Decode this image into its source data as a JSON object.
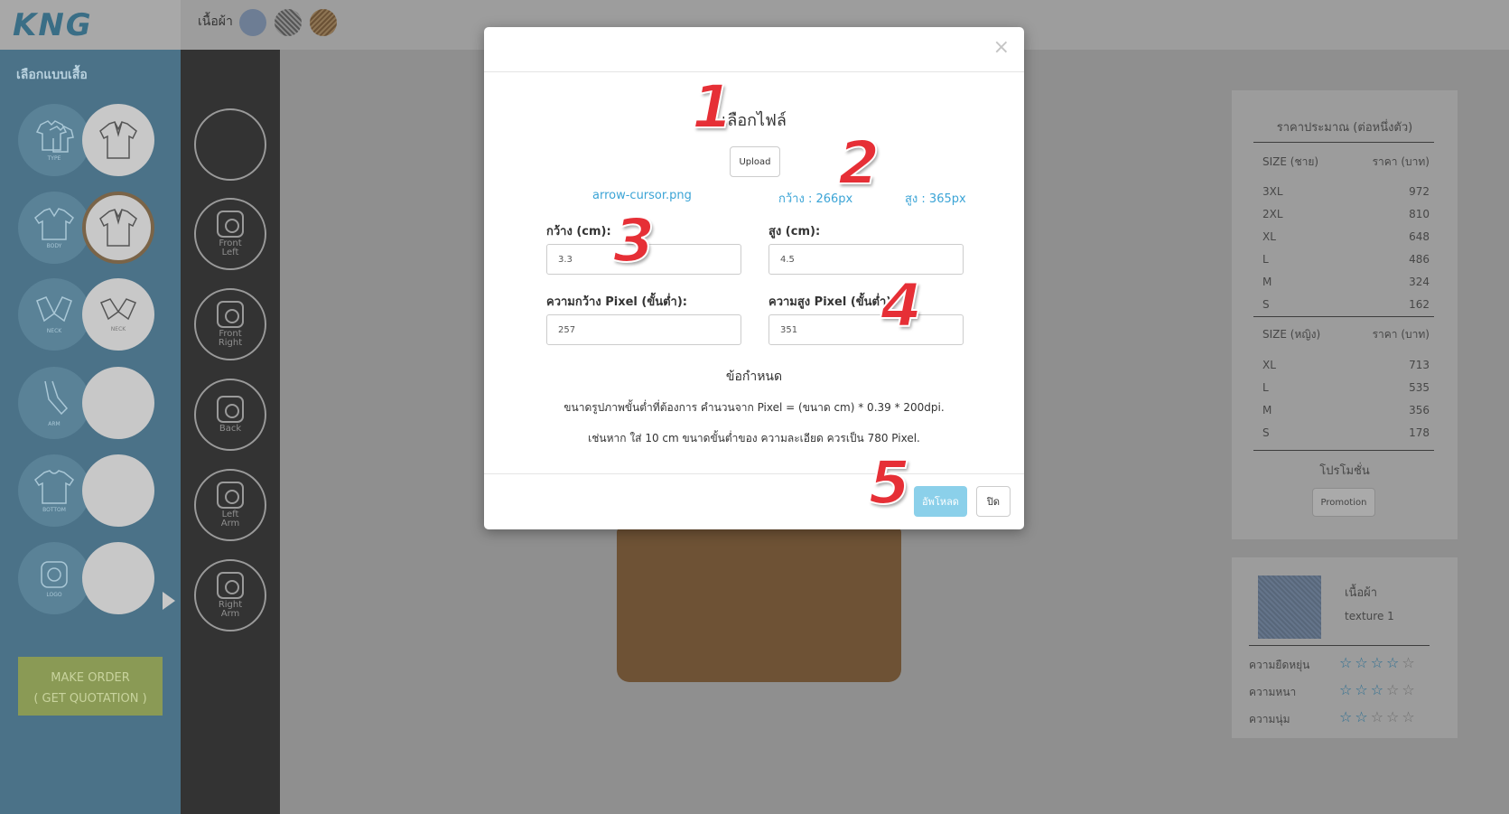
{
  "app": {
    "logo": "KNG",
    "fabric_label": "เนื้อผ้า",
    "fabric_swatches": [
      "blue-denim-swatch",
      "gray-weave-swatch",
      "brown-weave-swatch"
    ]
  },
  "left_panel": {
    "title": "เลือกแบบเสื้อ",
    "rows": [
      {
        "a_icon": "t-shirt-stack-icon",
        "a_caption": "TYPE",
        "b_icon": "polo-shirt-icon",
        "b_caption": ""
      },
      {
        "a_icon": "body-shirt-icon",
        "a_caption": "BODY",
        "b_icon": "polo-body-icon",
        "b_caption": ""
      },
      {
        "a_icon": "v-neck-icon",
        "a_caption": "NECK",
        "b_icon": "collar-neck-icon",
        "b_caption": "NECK"
      },
      {
        "a_icon": "sleeve-icon",
        "a_caption": "ARM",
        "b_icon": "",
        "b_caption": ""
      },
      {
        "a_icon": "shirt-bottom-icon",
        "a_caption": "BOTTOM",
        "b_icon": "",
        "b_caption": ""
      },
      {
        "a_icon": "logo-camera-icon",
        "a_caption": "LOGO",
        "b_icon": "",
        "b_caption": ""
      }
    ],
    "make_order_line1": "MAKE ORDER",
    "make_order_line2": "( GET QUOTATION )"
  },
  "view_column": {
    "buttons": [
      {
        "line1": "",
        "line2": ""
      },
      {
        "line1": "Front",
        "line2": "Left"
      },
      {
        "line1": "Front",
        "line2": "Right"
      },
      {
        "line1": "Back",
        "line2": ""
      },
      {
        "line1": "Left",
        "line2": "Arm"
      },
      {
        "line1": "Right",
        "line2": "Arm"
      }
    ]
  },
  "price_panel": {
    "title": "ราคาประมาณ (ต่อหนึ่งตัว)",
    "male_header": {
      "size": "SIZE (ชาย)",
      "price": "ราคา (บาท)"
    },
    "male_rows": [
      {
        "size": "3XL",
        "price": "972"
      },
      {
        "size": "2XL",
        "price": "810"
      },
      {
        "size": "XL",
        "price": "648"
      },
      {
        "size": "L",
        "price": "486"
      },
      {
        "size": "M",
        "price": "324"
      },
      {
        "size": "S",
        "price": "162"
      }
    ],
    "female_header": {
      "size": "SIZE (หญิง)",
      "price": "ราคา (บาท)"
    },
    "female_rows": [
      {
        "size": "XL",
        "price": "713"
      },
      {
        "size": "L",
        "price": "535"
      },
      {
        "size": "M",
        "price": "356"
      },
      {
        "size": "S",
        "price": "178"
      }
    ],
    "promo_label": "โปรโมชั่น",
    "promo_button": "Promotion"
  },
  "fabric_panel": {
    "name": "เนื้อผ้า",
    "texture": "texture 1",
    "ratings": [
      {
        "label": "ความยืดหยุ่น",
        "rating": 0
      },
      {
        "label": "ความหนา",
        "rating": 0
      },
      {
        "label": "ความนุ่ม",
        "rating": 0
      }
    ]
  },
  "modal": {
    "close": "×",
    "title": "เลือกไฟล์",
    "upload_button": "Upload",
    "file_name": "arrow-cursor.png",
    "width_px": "กว้าง : 266px",
    "height_px": "สูง : 365px",
    "width_cm_label": "กว้าง (cm):",
    "width_cm_value": "3.3",
    "height_cm_label": "สูง (cm):",
    "height_cm_value": "4.5",
    "min_width_px_label": "ความกว้าง Pixel (ขั้นต่ำ):",
    "min_width_px_value": "257",
    "min_height_px_label": "ความสูง Pixel (ขั้นต่ำ):",
    "min_height_px_value": "351",
    "rules_title": "ข้อกำหนด",
    "rule1": "ขนาดรูปภาพขั้นต่ำที่ต้องการ คำนวนจาก Pixel = (ขนาด cm) * 0.39 * 200dpi.",
    "rule2": "เช่นหาก ใส่ 10 cm ขนาดขั้นต่ำของ ความละเอียด ควรเป็น 780 Pixel.",
    "submit_button": "อัพโหลด",
    "cancel_button": "ปิด"
  },
  "annotations": [
    "1",
    "2",
    "3",
    "4",
    "5"
  ],
  "colors": {
    "accent_blue": "#3ba4d6",
    "upload_button": "#8bd0ea",
    "annotation_red": "#e62f36"
  }
}
